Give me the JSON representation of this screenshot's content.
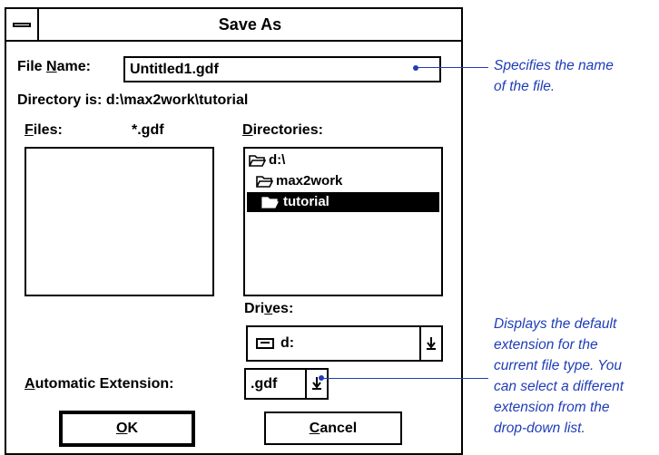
{
  "dialog": {
    "title": "Save As",
    "file_name_label_pre": "File ",
    "file_name_label_u": "N",
    "file_name_label_post": "ame:",
    "file_name_value": "Untitled1.gdf",
    "directory_label": "Directory is:",
    "directory_path": "d:\\max2work\\tutorial",
    "files_label_u": "F",
    "files_label_post": "iles:",
    "files_filter": "*.gdf",
    "directories_label_u": "D",
    "directories_label_post": "irectories:",
    "directories": [
      {
        "name": "d:\\",
        "selected": false
      },
      {
        "name": "max2work",
        "selected": false
      },
      {
        "name": "tutorial",
        "selected": true
      }
    ],
    "drives_label_pre": "Dri",
    "drives_label_u": "v",
    "drives_label_post": "es:",
    "drive_value": "d:",
    "ext_label_u": "A",
    "ext_label_post": "utomatic Extension:",
    "ext_value": ".gdf",
    "ok_label_u": "O",
    "ok_label_post": "K",
    "cancel_label_u": "C",
    "cancel_label_post": "ancel"
  },
  "callouts": {
    "name_lines": [
      "Specifies the name",
      "of the file."
    ],
    "ext_lines": [
      "Displays the default",
      "extension for the",
      "current file type. You",
      "can select a different",
      "extension from the",
      "drop-down list."
    ]
  },
  "colors": {
    "callout": "#1f3db8"
  }
}
